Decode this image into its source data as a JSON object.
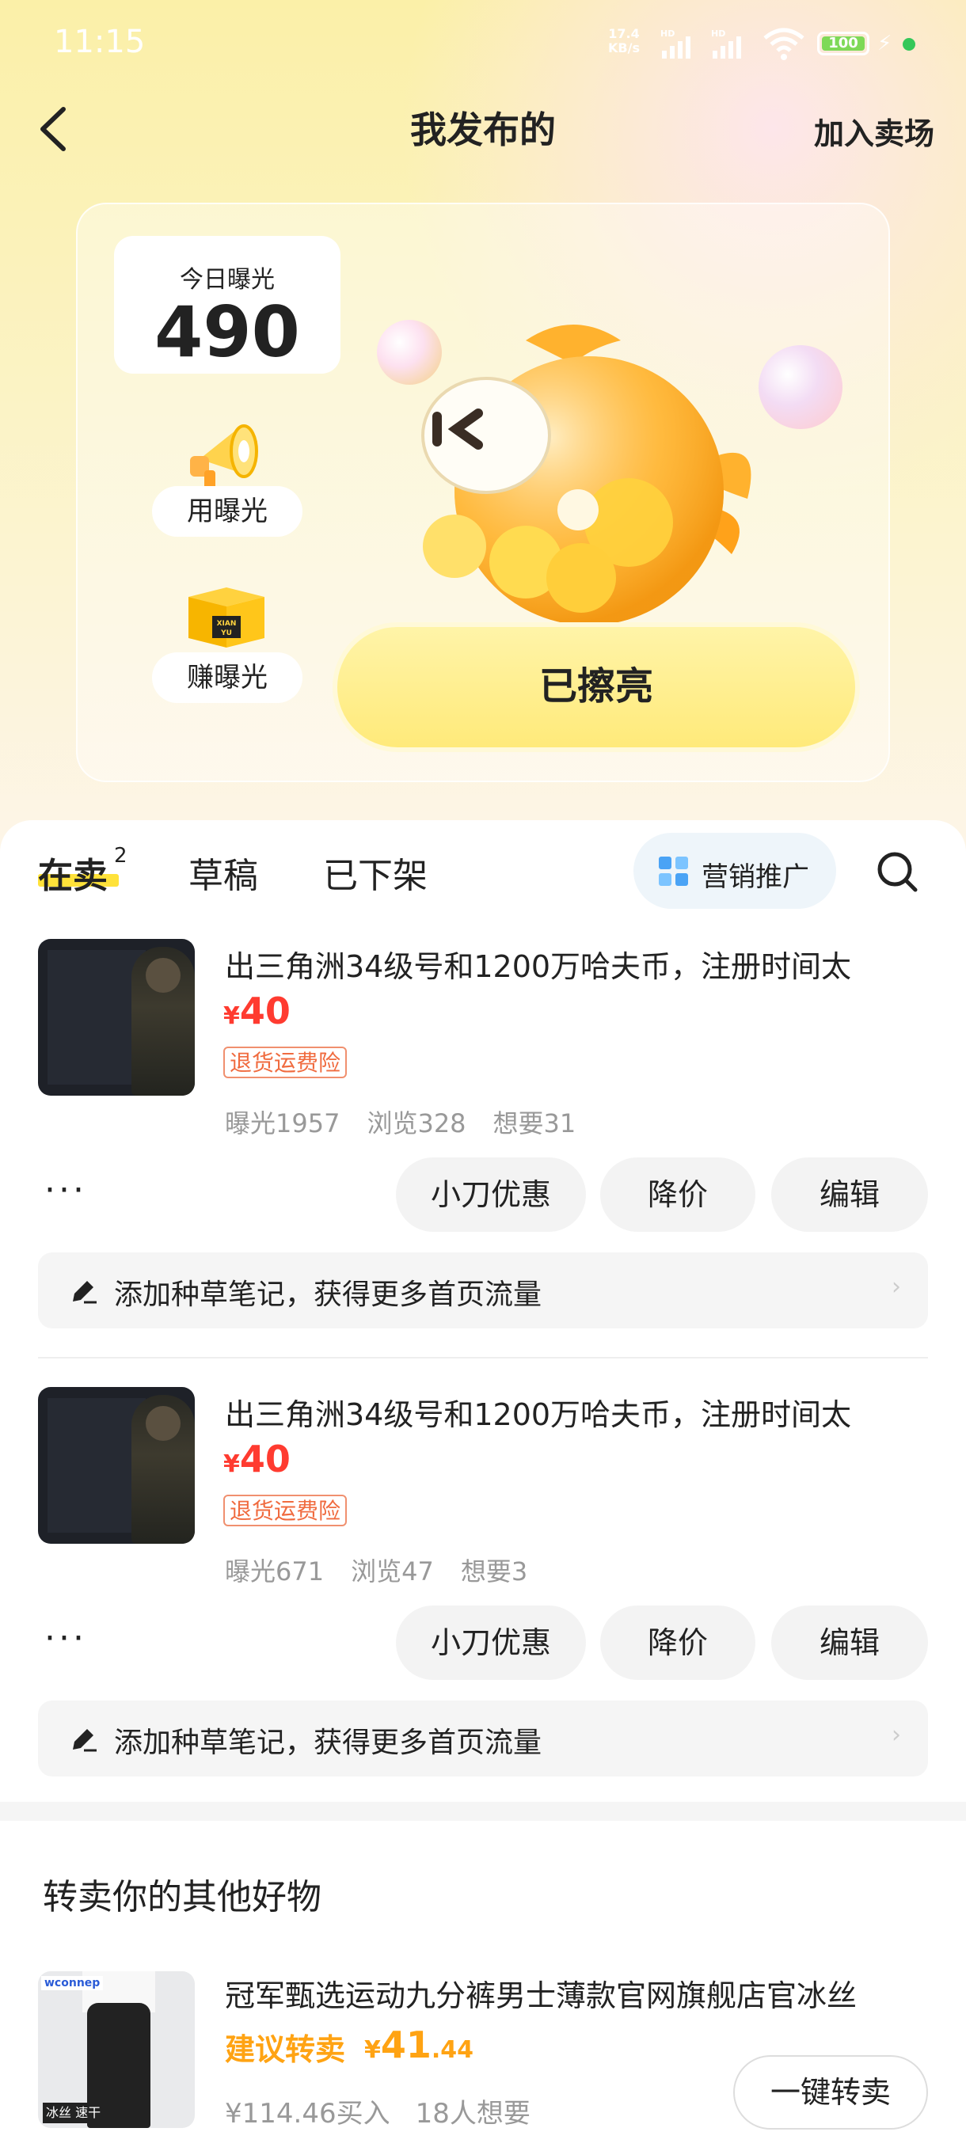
{
  "status_bar": {
    "time": "11:15",
    "net_speed": "17.4",
    "net_unit": "KB/s",
    "hd1": "HD",
    "hd2": "HD",
    "battery": "100"
  },
  "header": {
    "title": "我发布的",
    "action": "加入卖场"
  },
  "promo": {
    "exposure_label": "今日曝光",
    "exposure_value": "490",
    "use_label": "用曝光",
    "earn_label": "赚曝光",
    "box_text": "XIAN YU",
    "lit_button": "已擦亮"
  },
  "tabs": {
    "selling": "在卖",
    "selling_count": "2",
    "drafts": "草稿",
    "removed": "已下架",
    "marketing": "营销推广"
  },
  "listings": [
    {
      "title": "出三角洲34级号和1200万哈夫币，注册时间太",
      "currency": "¥",
      "price": "40",
      "tag": "退货运费险",
      "exposure": "曝光1957",
      "views": "浏览328",
      "wants": "想要31",
      "more": "···",
      "btn_discount": "小刀优惠",
      "btn_reduce": "降价",
      "btn_edit": "编辑",
      "note": "添加种草笔记，获得更多首页流量",
      "note_arrow": "›"
    },
    {
      "title": "出三角洲34级号和1200万哈夫币，注册时间太",
      "currency": "¥",
      "price": "40",
      "tag": "退货运费险",
      "exposure": "曝光671",
      "views": "浏览47",
      "wants": "想要3",
      "more": "···",
      "btn_discount": "小刀优惠",
      "btn_reduce": "降价",
      "btn_edit": "编辑",
      "note": "添加种草笔记，获得更多首页流量",
      "note_arrow": "›"
    }
  ],
  "resell": {
    "section_title": "转卖你的其他好物",
    "item_title": "冠军甄选运动九分裤男士薄款官网旗舰店官冰丝",
    "suggest_label": "建议转卖",
    "currency": "¥",
    "price_int": "41",
    "price_dec": ".44",
    "bought": "¥114.46买入",
    "wants": "18人想要",
    "button": "一键转卖",
    "thumb_brand": "wconnep",
    "thumb_badge": "冰丝 速干"
  },
  "colors": {
    "accent_yellow": "#ffe23a",
    "price_red": "#ff3b30",
    "suggest_orange": "#ffa313"
  }
}
